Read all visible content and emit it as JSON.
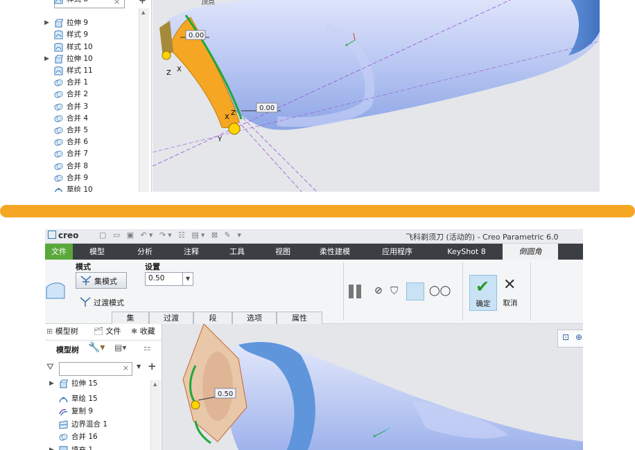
{
  "top_screen": {
    "tree_items": [
      {
        "label": "样式 8",
        "icon": "style-icon",
        "expand": false,
        "partial": true
      },
      {
        "label": "拉伸 9",
        "icon": "extrude-icon",
        "expand": true
      },
      {
        "label": "样式 9",
        "icon": "style-icon",
        "expand": false
      },
      {
        "label": "样式 10",
        "icon": "style-icon",
        "expand": false
      },
      {
        "label": "拉伸 10",
        "icon": "extrude-icon",
        "expand": true
      },
      {
        "label": "样式 11",
        "icon": "style-icon",
        "expand": false
      },
      {
        "label": "合并 1",
        "icon": "merge-icon",
        "expand": false
      },
      {
        "label": "合并 2",
        "icon": "merge-icon",
        "expand": false
      },
      {
        "label": "合并 3",
        "icon": "merge-icon",
        "expand": false
      },
      {
        "label": "合并 4",
        "icon": "merge-icon",
        "expand": false
      },
      {
        "label": "合并 5",
        "icon": "merge-icon",
        "expand": false
      },
      {
        "label": "合并 6",
        "icon": "merge-icon",
        "expand": false
      },
      {
        "label": "合并 7",
        "icon": "merge-icon",
        "expand": false
      },
      {
        "label": "合并 8",
        "icon": "merge-icon",
        "expand": false
      },
      {
        "label": "合并 9",
        "icon": "merge-icon",
        "expand": false
      },
      {
        "label": "草绘 10",
        "icon": "sketch-icon",
        "expand": false,
        "partial": true
      }
    ],
    "search_clear": "×",
    "add_symbol": "+",
    "viewport": {
      "dim_label_1": "0.00",
      "dim_label_2": "0.00",
      "top_label": "顶点",
      "axis_z1": "Z",
      "axis_x1": "X",
      "axis_z2": "Z",
      "axis_x2": "X",
      "axis_y": "Y"
    }
  },
  "divider_color": "#f5a623",
  "bottom_screen": {
    "logo": "creo",
    "window_title": "飞科剃须刀 (活动的) - Creo Parametric 6.0",
    "tabs": [
      {
        "label": "文件",
        "type": "file"
      },
      {
        "label": "模型"
      },
      {
        "label": "分析"
      },
      {
        "label": "注释"
      },
      {
        "label": "工具"
      },
      {
        "label": "视图"
      },
      {
        "label": "柔性建模"
      },
      {
        "label": "应用程序"
      },
      {
        "label": "KeyShot 8"
      },
      {
        "label": "倒圆角",
        "active": true
      }
    ],
    "ribbon": {
      "mode_label": "模式",
      "set_mode": "集模式",
      "transition_mode": "过渡模式",
      "settings_label": "设置",
      "radius_value": "0.50",
      "sub_tabs": [
        "集",
        "过渡",
        "段",
        "选项",
        "属性"
      ],
      "confirm": "确定",
      "cancel": "取消"
    },
    "tree_tabs": [
      "模型树",
      "文件",
      "收藏"
    ],
    "tree_header": "模型树",
    "search_clear": "×",
    "add_symbol": "+",
    "tree_items": [
      {
        "label": "拉伸 15",
        "icon": "extrude-icon",
        "expand": true,
        "partial": true
      },
      {
        "label": "草绘 15",
        "icon": "sketch-icon",
        "expand": false
      },
      {
        "label": "复制 9",
        "icon": "copy-icon",
        "expand": false
      },
      {
        "label": "边界混合 1",
        "icon": "boundary-blend-icon",
        "expand": false
      },
      {
        "label": "合并 16",
        "icon": "merge-icon",
        "expand": false
      },
      {
        "label": "填充 1",
        "icon": "fill-icon",
        "expand": true
      }
    ],
    "viewport": {
      "dim_label": "0.50"
    }
  },
  "colors": {
    "accent_green": "#5aa83a",
    "ribbon_dark": "#3b3f44",
    "model_blue": "#9fb8ee"
  }
}
